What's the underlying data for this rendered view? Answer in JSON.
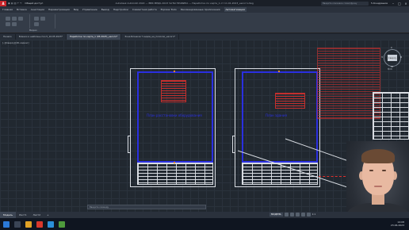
{
  "titlebar": {
    "logo": "A",
    "shared": "Общий доступ",
    "document": "Autodesk AutoCAD 2022 — ВВК МЕДЬ 2023 ЧАТЫ ПРАВИЛА — Наработки по карте_1 от 11.01.2023_несогл.dwg",
    "search": "Введите ключевое слово/фразу",
    "user": "5.Кондрашов",
    "min": "–",
    "max": "□",
    "close": "×"
  },
  "menu": [
    "Файл",
    "Правка",
    "Вид",
    "Вставка",
    "Формат",
    "Сервис",
    "Рисование",
    "Размеры",
    "Редакт.",
    "Параметры",
    "Окно",
    "Справка",
    "Express"
  ],
  "ribbon_tabs": [
    {
      "label": "Главная",
      "active": false
    },
    {
      "label": "Вставка",
      "active": false
    },
    {
      "label": "Аннотации",
      "active": false
    },
    {
      "label": "Параметризация",
      "active": false
    },
    {
      "label": "Вид",
      "active": false
    },
    {
      "label": "Управление",
      "active": false
    },
    {
      "label": "Вывод",
      "active": false
    },
    {
      "label": "Надстройки",
      "active": false
    },
    {
      "label": "Совместная работа",
      "active": false
    },
    {
      "label": "Express Tools",
      "active": false
    },
    {
      "label": "Рекомендованные приложения",
      "active": false
    },
    {
      "label": "Автоматизация",
      "active": true
    }
  ],
  "ribbon_label": "Видео",
  "doc_tabs": [
    {
      "label": "Начало",
      "active": false
    },
    {
      "label": "Бланки и шаблоны поз.5_16.05.2023*",
      "active": false
    },
    {
      "label": "Наработки по карте_1 (05.2023)_несогл*",
      "active": true
    },
    {
      "label": "Зона Бланков 7 видов_на_полосах_несогл*",
      "active": false
    }
  ],
  "viewport": {
    "label": "[–][Сверху][2D-каркас]",
    "sheet_left_title": "План расстановки оборудования",
    "sheet_right_title": "План здания"
  },
  "viewcube": {
    "north": "С",
    "south": "Ю",
    "west": "З",
    "east": "В",
    "face": "Сверху",
    "wcs": "МСК"
  },
  "command_placeholder": "Введите команду",
  "layout_tabs": [
    {
      "label": "Модель",
      "active": true
    },
    {
      "label": "Лист1",
      "active": false
    },
    {
      "label": "Лист2",
      "active": false
    },
    {
      "label": "+",
      "active": false
    }
  ],
  "status": {
    "model": "МОДЕЛЬ",
    "scale": "1:1"
  },
  "clock": {
    "time": "14:08",
    "date": "23.06.2023"
  },
  "colors": {
    "frame_blue": "#2a2fe0",
    "annotation_red": "#e0312d",
    "drawing_white": "#d8dce2",
    "accent": "#c8262b"
  }
}
